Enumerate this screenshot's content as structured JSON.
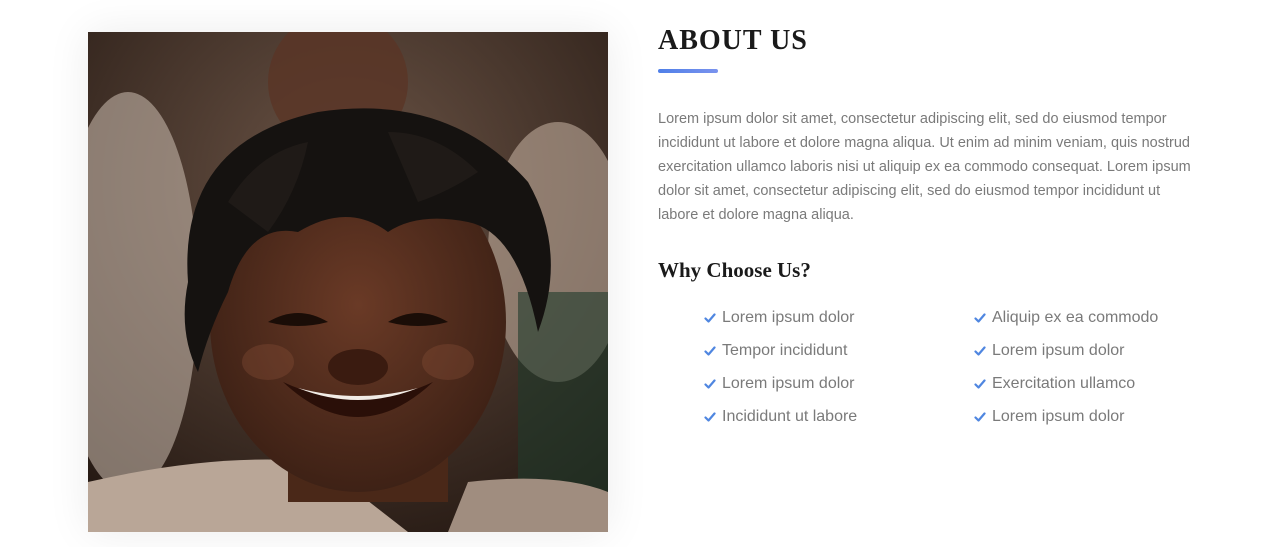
{
  "about": {
    "title": "ABOUT US",
    "paragraph": "Lorem ipsum dolor sit amet, consectetur adipiscing elit, sed do eiusmod tempor incididunt ut labore et dolore magna aliqua. Ut enim ad minim veniam, quis nostrud exercitation ullamco laboris nisi ut aliquip ex ea commodo consequat. Lorem ipsum dolor sit amet, consectetur adipiscing elit, sed do eiusmod tempor incididunt ut labore et dolore magna aliqua.",
    "accent_color": "#5b84ea"
  },
  "why": {
    "title": "Why Choose Us?",
    "icon": "check-icon",
    "items": [
      "Lorem ipsum dolor",
      "Aliquip ex ea commodo",
      "Tempor incididunt",
      "Lorem ipsum dolor",
      "Lorem ipsum dolor",
      "Exercitation ullamco",
      "Incididunt ut labore",
      "Lorem ipsum dolor"
    ]
  },
  "photo": {
    "subject": "smiling-boy-photo"
  }
}
